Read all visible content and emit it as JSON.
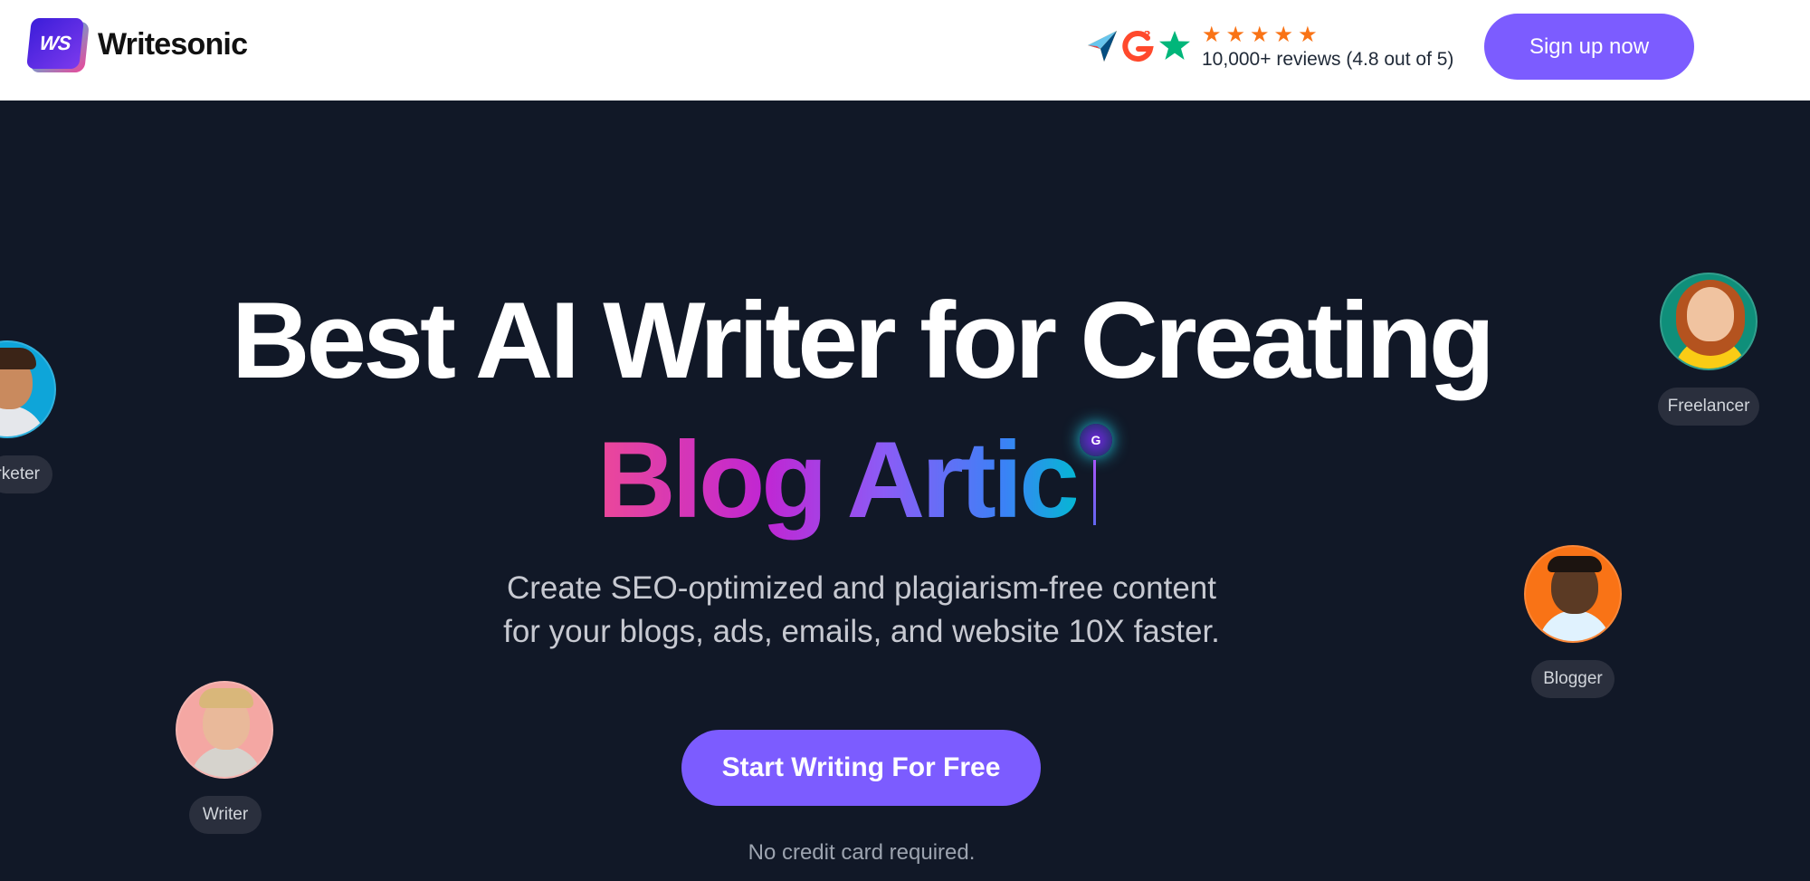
{
  "header": {
    "logo_mark": "WS",
    "brand_name": "Writesonic",
    "review_icons": [
      "capterra-icon",
      "g2-icon",
      "trustpilot-star-icon"
    ],
    "stars": [
      "★",
      "★",
      "★",
      "★",
      "★"
    ],
    "review_text": "10,000+ reviews (4.8 out of 5)",
    "signup_label": "Sign up now"
  },
  "hero": {
    "title_line1": "Best AI Writer for Creating",
    "typed_text": "Blog Artic",
    "cursor_badge": "G",
    "subtitle_line1": "Create SEO-optimized and plagiarism-free content",
    "subtitle_line2": "for your blogs, ads, emails, and website 10X faster.",
    "cta_label": "Start Writing For Free",
    "note": "No credit card required."
  },
  "personas": [
    {
      "label": "rketer"
    },
    {
      "label": "Freelancer"
    },
    {
      "label": "Blogger"
    },
    {
      "label": "Writer"
    }
  ],
  "colors": {
    "accent": "#7c5cff",
    "background": "#111827",
    "star": "#f97316",
    "gradient": [
      "#ec4899",
      "#8b5cf6",
      "#06b6d4"
    ]
  }
}
